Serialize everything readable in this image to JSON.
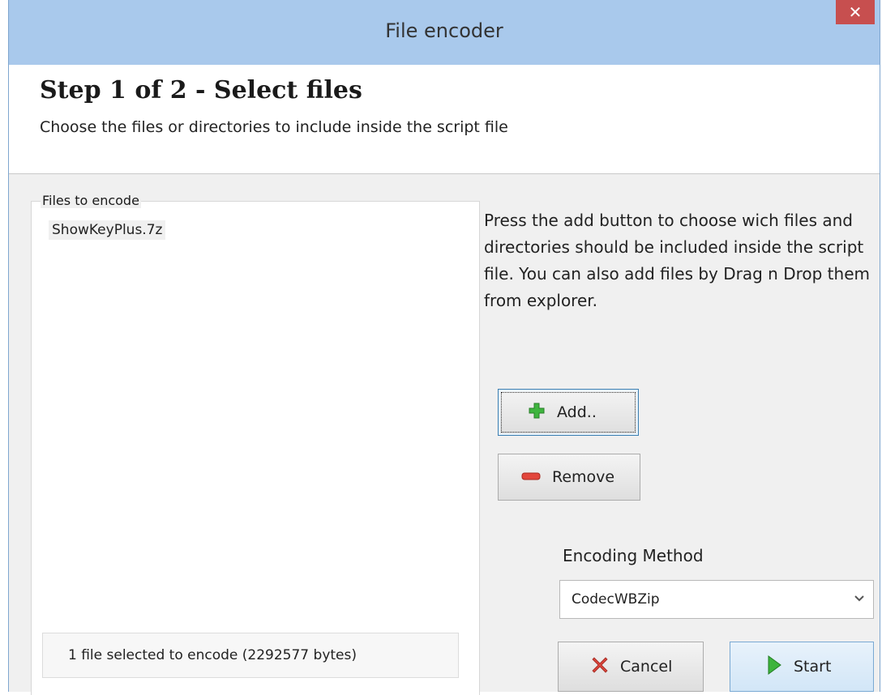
{
  "window": {
    "title": "File encoder",
    "close_label": "✕"
  },
  "header": {
    "step_title": "Step 1 of 2 - Select files",
    "step_subtitle": "Choose the files or directories to include inside the script file"
  },
  "files_panel": {
    "group_label": "Files to encode",
    "items": [
      "ShowKeyPlus.7z"
    ],
    "status": "1 file selected to encode (2292577 bytes)"
  },
  "help_text": "Press the add button to choose wich files and directories should be included inside the script file. You can also add files by Drag n Drop them from explorer.",
  "buttons": {
    "add_label": "Add..",
    "remove_label": "Remove",
    "cancel_label": "Cancel",
    "start_label": "Start"
  },
  "encoding": {
    "label": "Encoding Method",
    "selected": "CodecWBZip"
  },
  "icons": {
    "add": "plus-icon",
    "remove": "minus-icon",
    "cancel": "cancel-icon",
    "start": "play-icon",
    "close": "close-icon",
    "dropdown": "chevron-down-icon"
  },
  "colors": {
    "titlebar": "#a9c9ec",
    "close_button": "#c74f4f",
    "add_icon": "#3fb53f",
    "remove_icon": "#e2463c",
    "cancel_icon": "#d9433a",
    "start_icon": "#3db43d"
  }
}
